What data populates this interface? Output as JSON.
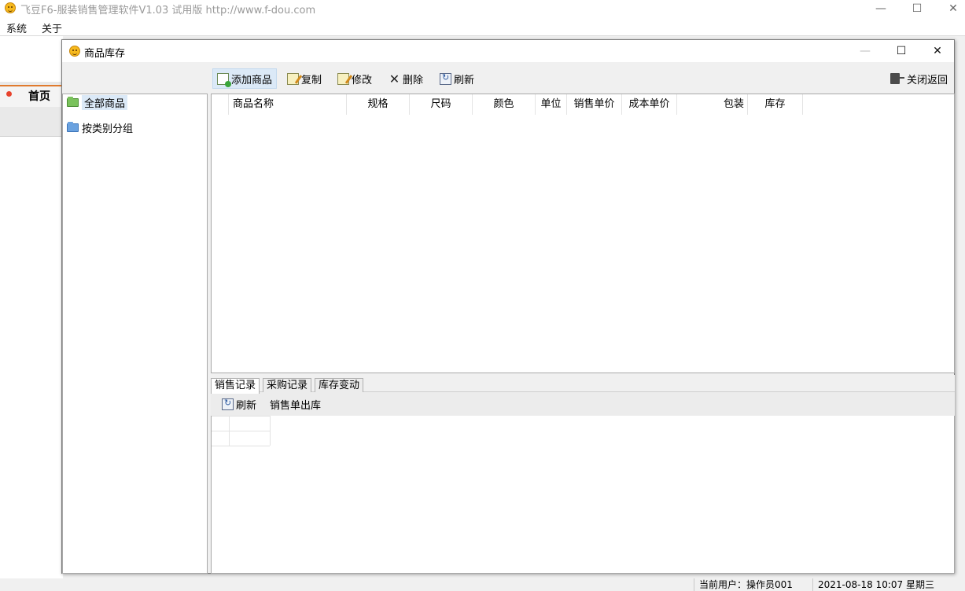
{
  "app": {
    "title": "飞豆F6-服装销售管理软件V1.03 试用版 http://www.f-dou.com",
    "window_buttons": {
      "minimize": "—",
      "maximize": "☐",
      "close": "✕"
    }
  },
  "menu": {
    "items": [
      "系统",
      "关于"
    ]
  },
  "home_tab": {
    "label": "首页"
  },
  "child_window": {
    "title": "商品库存",
    "buttons": {
      "minimize": "—",
      "maximize": "☐",
      "close": "✕"
    }
  },
  "toolbar": {
    "add": "添加商品",
    "copy": "复制",
    "edit": "修改",
    "delete": "删除",
    "refresh": "刷新",
    "close_return": "关闭返回"
  },
  "tree": {
    "items": [
      "全部商品",
      "按类别分组"
    ],
    "selected": "全部商品"
  },
  "grid": {
    "columns": [
      "商品名称",
      "规格",
      "尺码",
      "颜色",
      "单位",
      "销售单价",
      "成本单价",
      "包装",
      "库存"
    ],
    "rows": []
  },
  "bottom_tabs": {
    "items": [
      "销售记录",
      "采购记录",
      "库存变动"
    ],
    "active": "销售记录"
  },
  "sub_toolbar": {
    "refresh": "刷新",
    "sales_out": "销售单出库"
  },
  "status": {
    "user": "当前用户：操作员001",
    "datetime": "2021-08-18 10:07 星期三"
  },
  "colors": {
    "accent": "#e07a2e",
    "selection": "#dbe9f7",
    "home_dot": "#e8432d"
  }
}
